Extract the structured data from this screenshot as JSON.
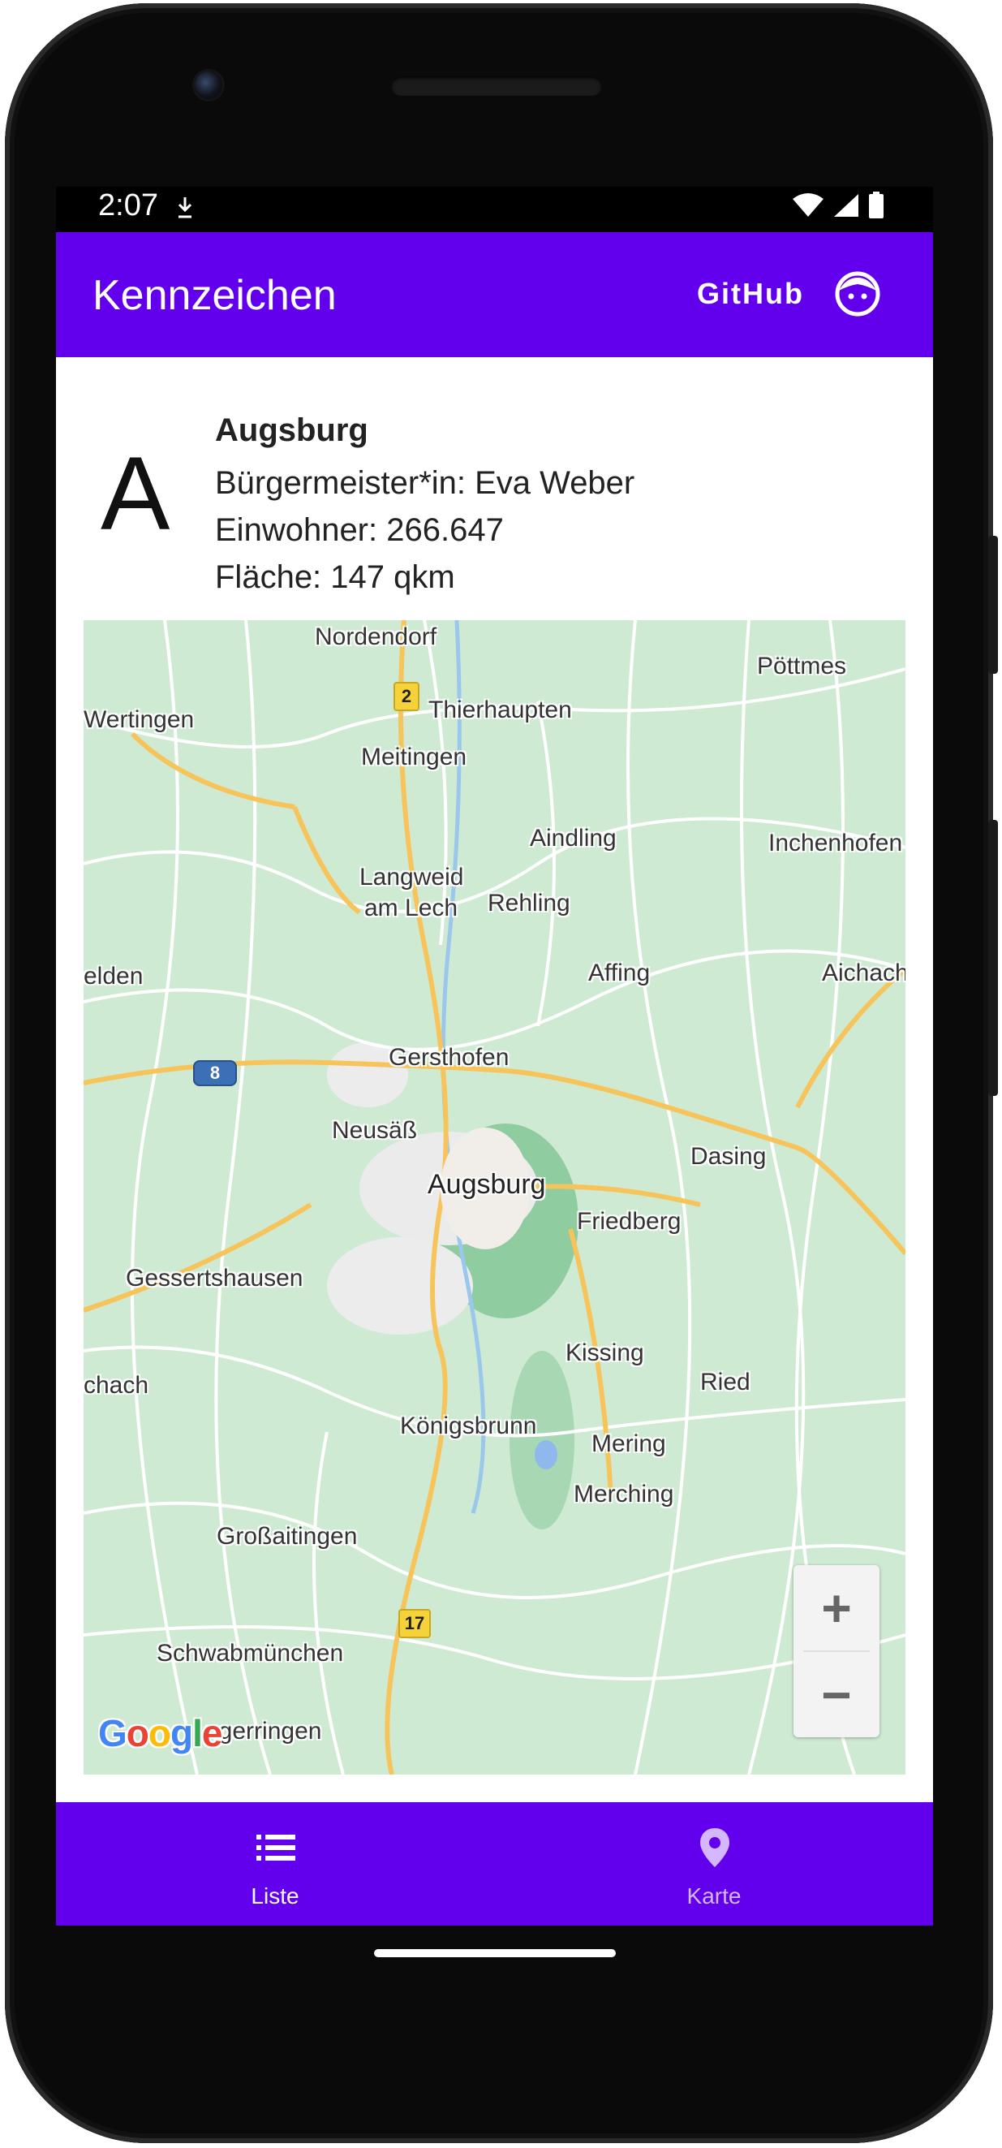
{
  "status_bar": {
    "time": "2:07"
  },
  "app_bar": {
    "title": "Kennzeichen",
    "github_label": "GitHub"
  },
  "detail": {
    "letter": "A",
    "city": "Augsburg",
    "mayor": "Bürgermeister*in: Eva Weber",
    "population": "Einwohner: 266.647",
    "area": "Fläche: 147 qkm"
  },
  "map": {
    "labels": {
      "nordendorf": "Nordendorf",
      "poettmes": "Pöttmes",
      "wertingen": "Wertingen",
      "thierhaupten": "Thierhaupten",
      "meitingen": "Meitingen",
      "aindling": "Aindling",
      "inchenhofen": "Inchenhofen",
      "langweid": "Langweid",
      "am_lech": "am Lech",
      "rehling": "Rehling",
      "elden": "elden",
      "affing": "Affing",
      "aichach": "Aichach",
      "gersthofen": "Gersthofen",
      "neusaess": "Neusäß",
      "augsburg": "Augsburg",
      "dasing": "Dasing",
      "friedberg": "Friedberg",
      "gessertshausen": "Gessertshausen",
      "kissing": "Kissing",
      "chach": "chach",
      "ried": "Ried",
      "koenigsbrunn": "Königsbrunn",
      "mering": "Mering",
      "merching": "Merching",
      "grossaitingen": "Großaitingen",
      "schwabmuenchen": "Schwabmünchen",
      "ngerringen": "ngerringen"
    },
    "route_shields": {
      "b2": "2",
      "a8": "8",
      "b17": "17"
    },
    "zoom_in": "+",
    "zoom_out": "−",
    "attribution": "Google"
  },
  "bottom_nav": {
    "items": [
      {
        "label": "Liste",
        "icon": "list-icon"
      },
      {
        "label": "Karte",
        "icon": "map-pin-icon"
      }
    ]
  },
  "colors": {
    "primary": "#6200ee",
    "map_green": "#d4eed8",
    "road": "#f6c45a"
  }
}
